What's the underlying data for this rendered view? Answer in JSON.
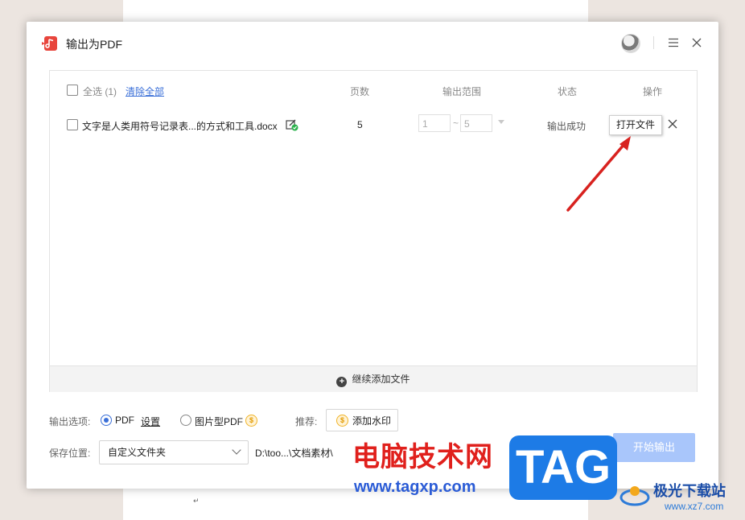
{
  "dialog": {
    "title": "输出为PDF"
  },
  "table": {
    "select_all_label": "全选",
    "selected_count": "(1)",
    "clear_all": "清除全部",
    "headers": {
      "pages": "页数",
      "range": "输出范围",
      "status": "状态",
      "ops": "操作"
    },
    "rows": [
      {
        "name": "文字是人类用符号记录表...的方式和工具.docx",
        "pages": "5",
        "range_from": "1",
        "range_sep": "~",
        "range_to": "5",
        "status": "输出成功"
      }
    ]
  },
  "tooltip": "打开文件",
  "add_files": "继续添加文件",
  "options": {
    "label": "输出选项:",
    "pdf": "PDF",
    "settings": "设置",
    "image_pdf": "图片型PDF",
    "coin_symbol": "$",
    "recommend_label": "推荐:",
    "watermark_button": "添加水印"
  },
  "save": {
    "label": "保存位置:",
    "folder_option": "自定义文件夹",
    "path": "D:\\too...\\文档素材\\"
  },
  "start_button": "开始输出",
  "overlay": {
    "site_name": "电脑技术网",
    "site_url": "www.tagxp.com",
    "tag_logo": "TAG",
    "xz_name": "极光下载站",
    "xz_url": "www.xz7.com"
  },
  "colors": {
    "accent": "#3a6fd8",
    "start_button_bg": "#a9c6fb",
    "arrow": "#d8221f",
    "status_ok_green": "#2bb24c"
  },
  "doc_mark": "↵"
}
